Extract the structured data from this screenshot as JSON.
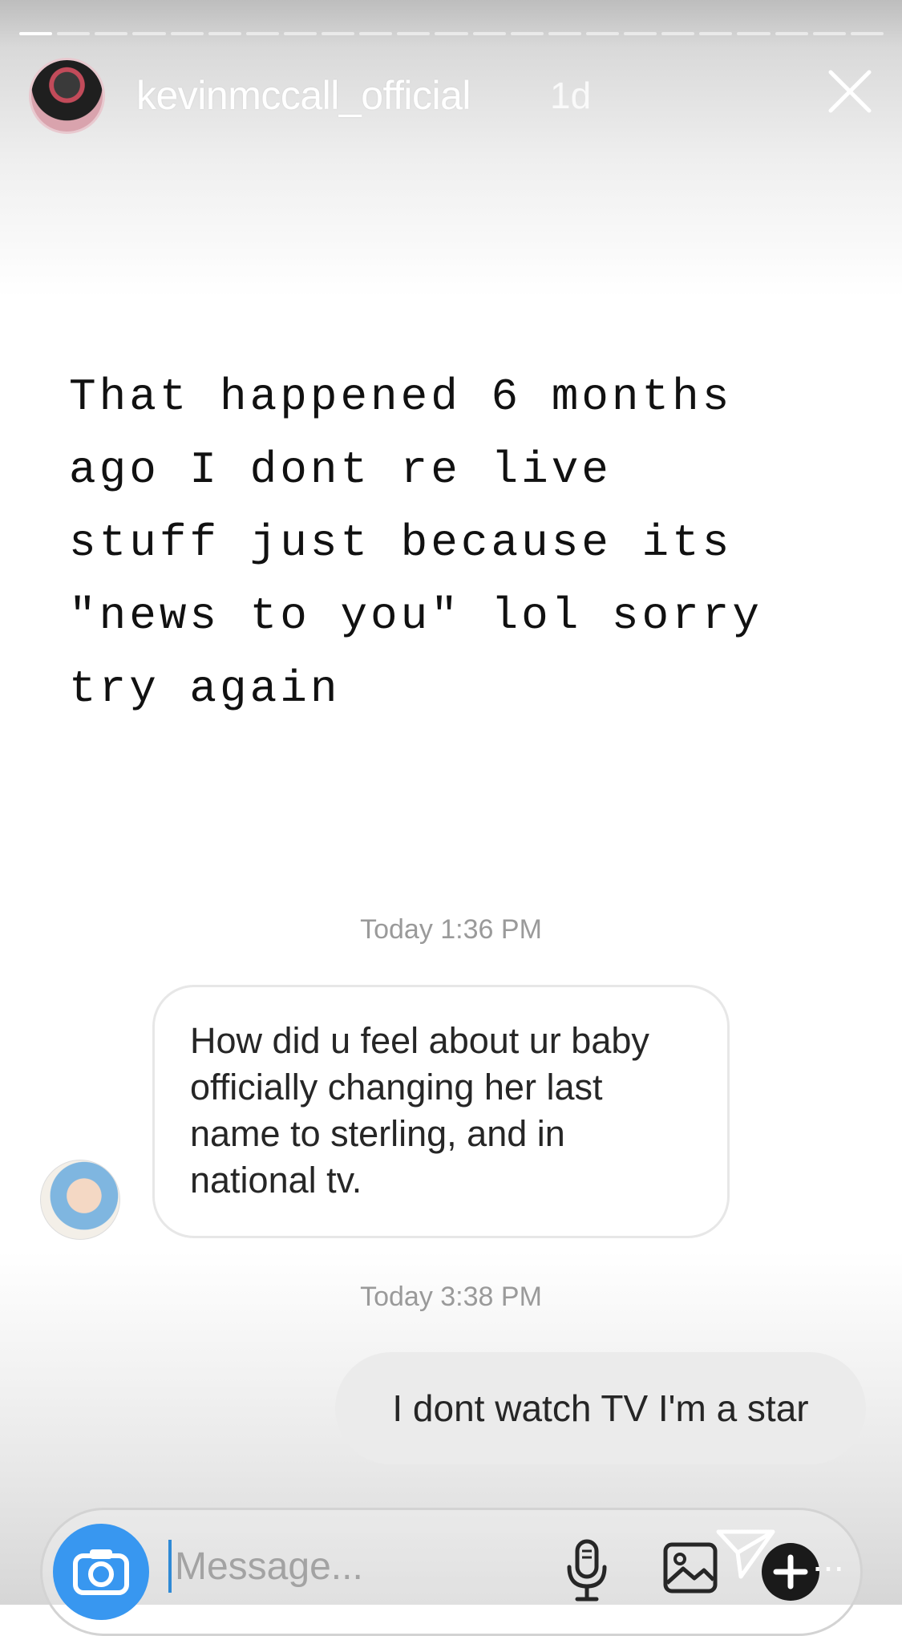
{
  "story": {
    "username": "kevinmccall_official",
    "time_ago": "1d",
    "text": "That happened 6 months\nago I dont re live\nstuff just because its\n\"news to you\" lol sorry\ntry again"
  },
  "conversation": {
    "timestamp_1": "Today 1:36 PM",
    "incoming_message": "How did u feel about ur baby officially changing her last name to sterling, and in national tv.",
    "timestamp_2": "Today 3:38 PM",
    "outgoing_message": "I dont watch TV I'm a star"
  },
  "composer": {
    "placeholder": "Message..."
  },
  "icons": {
    "close": "close-icon",
    "camera": "camera-icon",
    "mic": "microphone-icon",
    "image": "image-icon",
    "send": "send-icon",
    "add": "add-icon",
    "more": "more-icon"
  },
  "colors": {
    "accent": "#3897f0",
    "text": "#262626",
    "muted": "#9a9a9a"
  },
  "progress": {
    "segments": 23,
    "active_index": 0
  }
}
